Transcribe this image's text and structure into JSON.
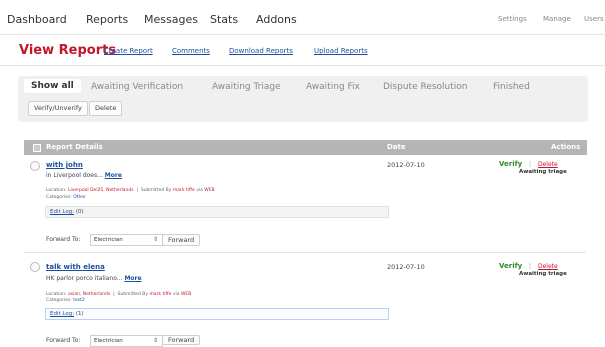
{
  "nav": {
    "items": [
      "Dashboard",
      "Reports",
      "Messages",
      "Stats",
      "Addons"
    ],
    "right": [
      "Settings",
      "Manage",
      "Users"
    ]
  },
  "page": {
    "title": "View Reports",
    "links": [
      "Create Report",
      "Comments",
      "Download Reports",
      "Upload Reports"
    ]
  },
  "tabs": [
    "Show all",
    "Awaiting Verification",
    "Awaiting Triage",
    "Awaiting Fix",
    "Dispute Resolution",
    "Finished"
  ],
  "actions": {
    "verify_unverify": "Verify/Unverify",
    "delete": "Delete"
  },
  "table": {
    "headers": {
      "details": "Report Details",
      "date": "Date",
      "actions": "Actions"
    }
  },
  "reports": [
    {
      "title": "with john",
      "desc": "in Liverpool does...",
      "more": "More",
      "location_label": "Location:",
      "location": "Liverpool Del25, Netherlands",
      "submitted_label": "Submitted By",
      "submitter": "mark tiffe",
      "via_label": "via",
      "via": "WEB",
      "categories_label": "Categories:",
      "category": "Other",
      "editlog_label": "Edit Log:",
      "editlog_count": "(0)",
      "forward_label": "Forward To:",
      "forward_option": "Electrician",
      "forward_button": "Forward",
      "date": "2012-07-10",
      "verify": "Verify",
      "sep": "|",
      "delete": "Delete",
      "status": "Awaiting triage"
    },
    {
      "title": "talk with elena",
      "desc": "HK parlor porco italiano...",
      "more": "More",
      "location_label": "Location:",
      "location": "asian, Netherlands",
      "submitted_label": "Submitted By",
      "submitter": "mark tiffe",
      "via_label": "via",
      "via": "WEB",
      "categories_label": "Categories:",
      "category": "test2",
      "editlog_label": "Edit Log:",
      "editlog_count": "(1)",
      "forward_label": "Forward To:",
      "forward_option": "Electrician",
      "forward_button": "Forward",
      "date": "2012-07-10",
      "verify": "Verify",
      "sep": "|",
      "delete": "Delete",
      "status": "Awaiting triage"
    }
  ]
}
